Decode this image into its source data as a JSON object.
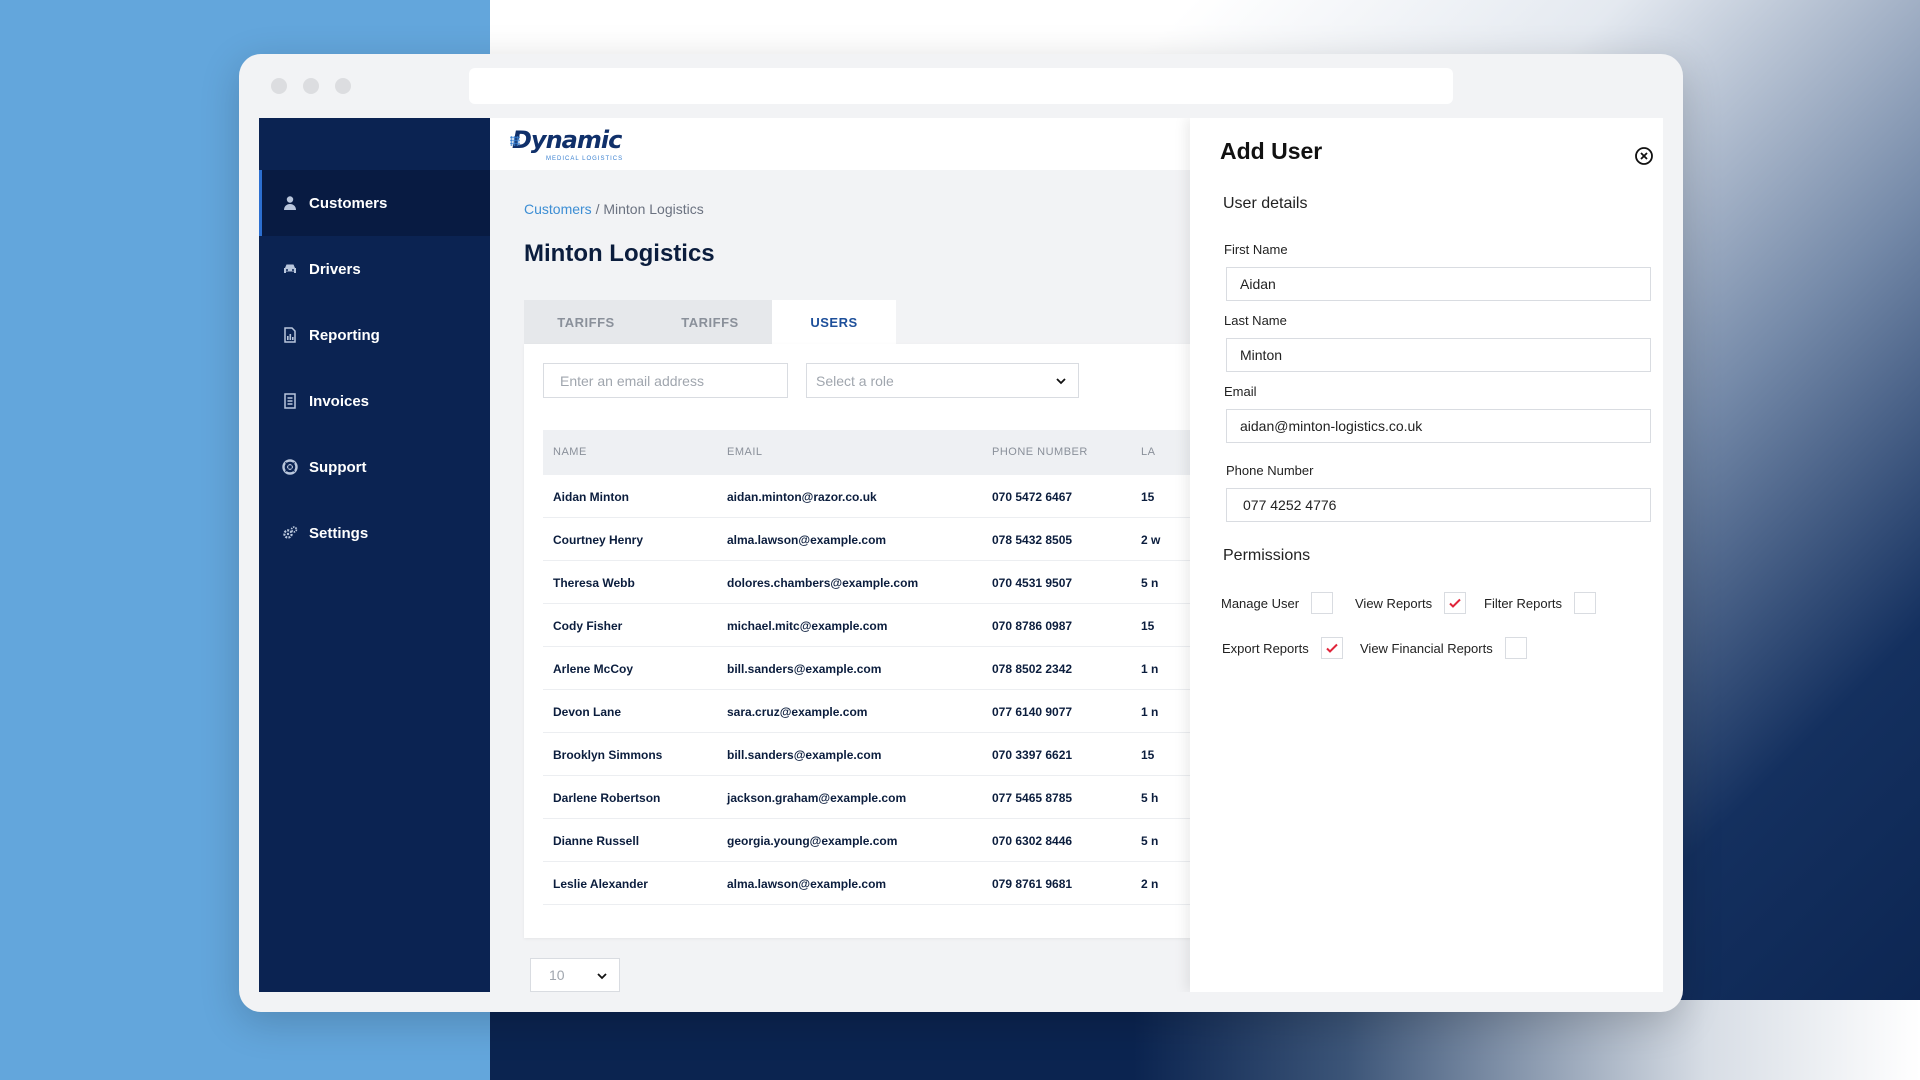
{
  "sidebar": {
    "items": [
      {
        "label": "Customers",
        "icon": "user-icon",
        "active": true
      },
      {
        "label": "Drivers",
        "icon": "car-icon",
        "active": false
      },
      {
        "label": "Reporting",
        "icon": "report-icon",
        "active": false
      },
      {
        "label": "Invoices",
        "icon": "invoice-icon",
        "active": false
      },
      {
        "label": "Support",
        "icon": "lifebuoy-icon",
        "active": false
      },
      {
        "label": "Settings",
        "icon": "gears-icon",
        "active": false
      }
    ]
  },
  "logo": {
    "name": "Dynamic",
    "tagline": "MEDICAL LOGISTICS"
  },
  "breadcrumb": {
    "root": "Customers",
    "separator": "/",
    "current": "Minton Logistics"
  },
  "page_title": "Minton Logistics",
  "tabs": [
    {
      "label": "TARIFFS",
      "active": false
    },
    {
      "label": "TARIFFS",
      "active": false
    },
    {
      "label": "USERS",
      "active": true
    }
  ],
  "filters": {
    "email_placeholder": "Enter an email address",
    "role_placeholder": "Select a role"
  },
  "table": {
    "columns": [
      "NAME",
      "EMAIL",
      "PHONE NUMBER",
      "LA"
    ],
    "rows": [
      {
        "name": "Aidan Minton",
        "email": "aidan.minton@razor.co.uk",
        "phone": "070 5472 6467",
        "last": "15"
      },
      {
        "name": "Courtney Henry",
        "email": "alma.lawson@example.com",
        "phone": "078 5432 8505",
        "last": "2 w"
      },
      {
        "name": "Theresa Webb",
        "email": "dolores.chambers@example.com",
        "phone": "070 4531 9507",
        "last": "5 n"
      },
      {
        "name": "Cody Fisher",
        "email": "michael.mitc@example.com",
        "phone": "070 8786 0987",
        "last": "15"
      },
      {
        "name": "Arlene McCoy",
        "email": "bill.sanders@example.com",
        "phone": "078 8502 2342",
        "last": "1 n"
      },
      {
        "name": "Devon Lane",
        "email": "sara.cruz@example.com",
        "phone": "077 6140 9077",
        "last": "1 n"
      },
      {
        "name": "Brooklyn Simmons",
        "email": "bill.sanders@example.com",
        "phone": "070 3397 6621",
        "last": "15"
      },
      {
        "name": "Darlene Robertson",
        "email": "jackson.graham@example.com",
        "phone": "077 5465 8785",
        "last": "5 h"
      },
      {
        "name": "Dianne Russell",
        "email": "georgia.young@example.com",
        "phone": "070 6302 8446",
        "last": "5 n"
      },
      {
        "name": "Leslie Alexander",
        "email": "alma.lawson@example.com",
        "phone": "079 8761 9681",
        "last": "2 n"
      }
    ]
  },
  "pagination": {
    "page_size": "10"
  },
  "panel": {
    "title": "Add User",
    "section_details": "User details",
    "fields": {
      "first_name": {
        "label": "First Name",
        "value": "Aidan"
      },
      "last_name": {
        "label": "Last Name",
        "value": "Minton"
      },
      "email": {
        "label": "Email",
        "value": "aidan@minton-logistics.co.uk"
      },
      "phone": {
        "label": "Phone Number",
        "value": "077 4252 4776"
      }
    },
    "section_permissions": "Permissions",
    "permissions": [
      {
        "label": "Manage User",
        "checked": false
      },
      {
        "label": "View Reports",
        "checked": true
      },
      {
        "label": "Filter Reports",
        "checked": false
      },
      {
        "label": "Export Reports",
        "checked": true
      },
      {
        "label": "View Financial Reports",
        "checked": false
      }
    ]
  },
  "colors": {
    "sidebar_bg": "#0b2352",
    "accent": "#3d8ed4",
    "check": "#e0243a"
  }
}
